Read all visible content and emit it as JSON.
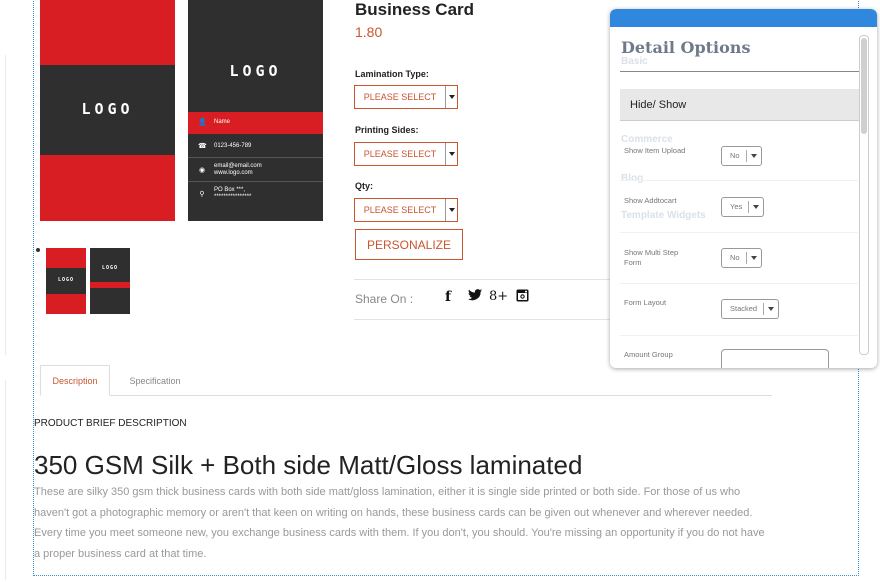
{
  "product": {
    "title": "Business Card",
    "price": "1.80",
    "card": {
      "logo_text": "LOGO",
      "name": "Name",
      "phone": "0123-456-789",
      "email": "email@email.com",
      "web": "www.logo.com",
      "address": "PO Box ***,",
      "address2": "****************",
      "thumb_logo": "LOGO",
      "thumb_logo2": "LOGO"
    },
    "options": [
      {
        "label": "Lamination Type:",
        "value": "PLEASE SELECT"
      },
      {
        "label": "Printing Sides:",
        "value": "PLEASE SELECT"
      },
      {
        "label": "Qty:",
        "value": "PLEASE SELECT"
      }
    ],
    "personalize_label": "PERSONALIZE",
    "share_label": "Share On :",
    "share_icons": [
      {
        "name": "facebook-icon",
        "glyph": "f"
      },
      {
        "name": "twitter-icon",
        "glyph": "🐦"
      },
      {
        "name": "google-plus-icon",
        "glyph": "8+"
      },
      {
        "name": "instagram-icon",
        "glyph": "◙"
      }
    ]
  },
  "tabs": [
    {
      "label": "Description",
      "active": true
    },
    {
      "label": "Specification",
      "active": false
    }
  ],
  "description": {
    "brief_label": "PRODUCT BRIEF DESCRIPTION",
    "headline": "350 GSM Silk + Both side Matt/Gloss laminated",
    "body": "These are silky 350 gsm thick business cards with both side matt/gloss lamination, either it is single side printed or both side. For those of us who haven't got a photographic memory or aren't that keen on writing on hands, these business cards can be given out whenever and wherever needed. Every time you meet someone new, you exchange business cards with them. If you don't, you should. You're missing an opportunity if you do not have a proper business card at that time."
  },
  "panel": {
    "title": "Detail Options",
    "ghost_basic": "Basic",
    "ghost_commerce": "Commerce",
    "ghost_blog": "Blog",
    "ghost_template": "Template Widgets",
    "section": "Hide/ Show",
    "rows": [
      {
        "label": "Show Item Upload",
        "value": "No"
      },
      {
        "label": "Show Addtocart",
        "value": "Yes"
      },
      {
        "label": "Show Multi Step Form",
        "value": "No"
      },
      {
        "label": "Form Layout",
        "value": "Stacked"
      },
      {
        "label": "Amount Group",
        "value": ""
      }
    ]
  },
  "colors": {
    "accent": "#c8562f",
    "card_red": "#d81e22",
    "card_dark": "#2f2f2f",
    "panel_blue": "#2f88dd",
    "frame": "#3a8fd6"
  }
}
